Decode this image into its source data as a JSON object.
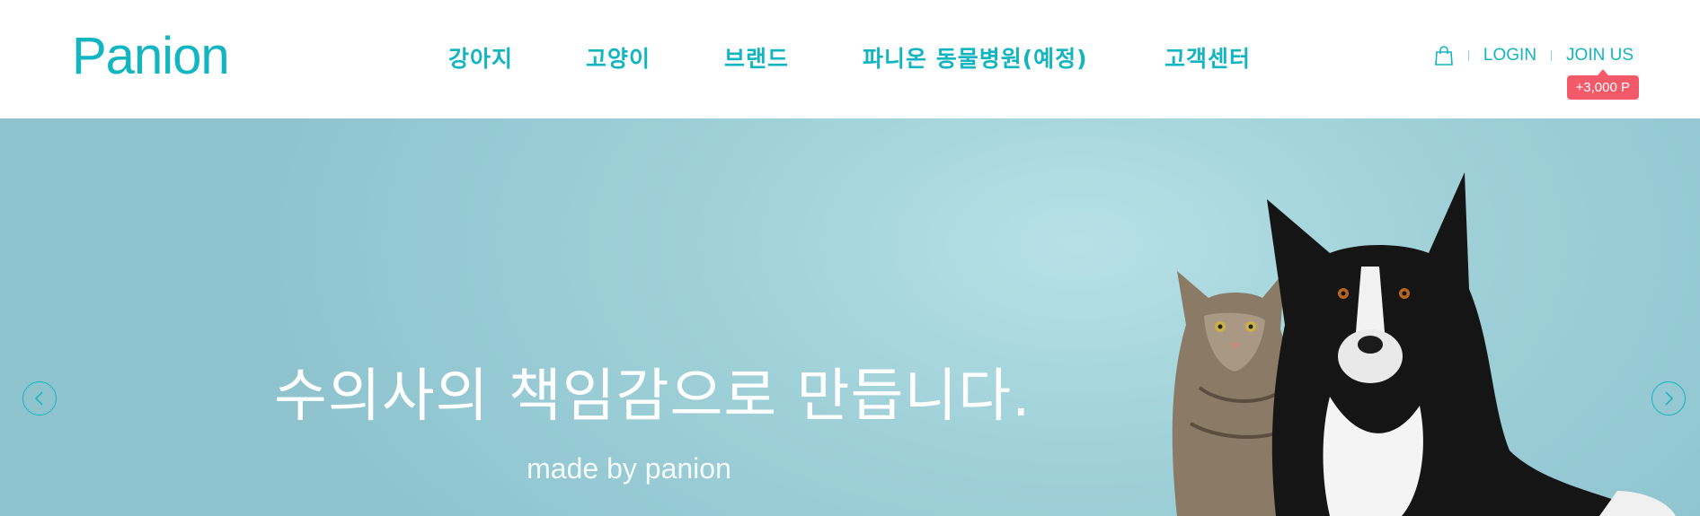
{
  "header": {
    "logo_text": "Panion",
    "nav": [
      {
        "label": "강아지"
      },
      {
        "label": "고양이"
      },
      {
        "label": "브랜드"
      },
      {
        "label": "파니온 동물병원(예정)"
      },
      {
        "label": "고객센터"
      }
    ],
    "util": {
      "login_label": "LOGIN",
      "join_label": "JOIN US",
      "point_badge": "+3,000 P"
    }
  },
  "hero": {
    "title": "수의사의 책임감으로 만듭니다.",
    "subtitle": "made by panion"
  },
  "colors": {
    "brand": "#12b5c0",
    "badge": "#f25a6a",
    "hero_bg": "#9fd0d8"
  }
}
